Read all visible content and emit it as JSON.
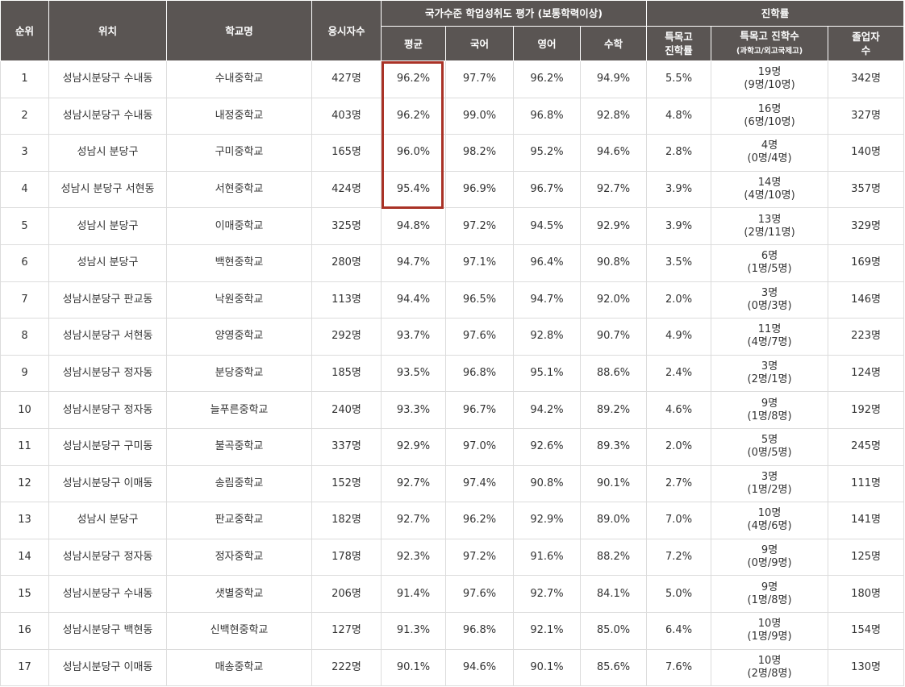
{
  "header": {
    "rank": "순위",
    "location": "위치",
    "school": "학교명",
    "examinees": "응시자수",
    "national_eval": "국가수준 학업성취도 평가 (보통학력이상)",
    "avg": "평균",
    "korean": "국어",
    "english": "영어",
    "math": "수학",
    "advancement": "진학률",
    "special_rate_line1": "특목고",
    "special_rate_line2": "진학률",
    "special_count_line1": "특목고 진학수",
    "special_count_line2": "(과학고/외고국제고)",
    "graduates_line1": "졸업자",
    "graduates_line2": "수"
  },
  "rows": [
    {
      "rank": "1",
      "location": "성남시분당구 수내동",
      "school": "수내중학교",
      "examinees": "427명",
      "avg": "96.2%",
      "korean": "97.7%",
      "english": "96.2%",
      "math": "94.9%",
      "special_rate": "5.5%",
      "special_total": "19명",
      "special_detail": "(9명/10명)",
      "graduates": "342명"
    },
    {
      "rank": "2",
      "location": "성남시분당구 수내동",
      "school": "내정중학교",
      "examinees": "403명",
      "avg": "96.2%",
      "korean": "99.0%",
      "english": "96.8%",
      "math": "92.8%",
      "special_rate": "4.8%",
      "special_total": "16명",
      "special_detail": "(6명/10명)",
      "graduates": "327명"
    },
    {
      "rank": "3",
      "location": "성남시 분당구",
      "school": "구미중학교",
      "examinees": "165명",
      "avg": "96.0%",
      "korean": "98.2%",
      "english": "95.2%",
      "math": "94.6%",
      "special_rate": "2.8%",
      "special_total": "4명",
      "special_detail": "(0명/4명)",
      "graduates": "140명"
    },
    {
      "rank": "4",
      "location": "성남시 분당구 서현동",
      "school": "서현중학교",
      "examinees": "424명",
      "avg": "95.4%",
      "korean": "96.9%",
      "english": "96.7%",
      "math": "92.7%",
      "special_rate": "3.9%",
      "special_total": "14명",
      "special_detail": "(4명/10명)",
      "graduates": "357명"
    },
    {
      "rank": "5",
      "location": "성남시 분당구",
      "school": "이매중학교",
      "examinees": "325명",
      "avg": "94.8%",
      "korean": "97.2%",
      "english": "94.5%",
      "math": "92.9%",
      "special_rate": "3.9%",
      "special_total": "13명",
      "special_detail": "(2명/11명)",
      "graduates": "329명"
    },
    {
      "rank": "6",
      "location": "성남시 분당구",
      "school": "백현중학교",
      "examinees": "280명",
      "avg": "94.7%",
      "korean": "97.1%",
      "english": "96.4%",
      "math": "90.8%",
      "special_rate": "3.5%",
      "special_total": "6명",
      "special_detail": "(1명/5명)",
      "graduates": "169명"
    },
    {
      "rank": "7",
      "location": "성남시분당구 판교동",
      "school": "낙원중학교",
      "examinees": "113명",
      "avg": "94.4%",
      "korean": "96.5%",
      "english": "94.7%",
      "math": "92.0%",
      "special_rate": "2.0%",
      "special_total": "3명",
      "special_detail": "(0명/3명)",
      "graduates": "146명"
    },
    {
      "rank": "8",
      "location": "성남시분당구 서현동",
      "school": "양영중학교",
      "examinees": "292명",
      "avg": "93.7%",
      "korean": "97.6%",
      "english": "92.8%",
      "math": "90.7%",
      "special_rate": "4.9%",
      "special_total": "11명",
      "special_detail": "(4명/7명)",
      "graduates": "223명"
    },
    {
      "rank": "9",
      "location": "성남시분당구 정자동",
      "school": "분당중학교",
      "examinees": "185명",
      "avg": "93.5%",
      "korean": "96.8%",
      "english": "95.1%",
      "math": "88.6%",
      "special_rate": "2.4%",
      "special_total": "3명",
      "special_detail": "(2명/1명)",
      "graduates": "124명"
    },
    {
      "rank": "10",
      "location": "성남시분당구 정자동",
      "school": "늘푸른중학교",
      "examinees": "240명",
      "avg": "93.3%",
      "korean": "96.7%",
      "english": "94.2%",
      "math": "89.2%",
      "special_rate": "4.6%",
      "special_total": "9명",
      "special_detail": "(1명/8명)",
      "graduates": "192명"
    },
    {
      "rank": "11",
      "location": "성남시분당구 구미동",
      "school": "불곡중학교",
      "examinees": "337명",
      "avg": "92.9%",
      "korean": "97.0%",
      "english": "92.6%",
      "math": "89.3%",
      "special_rate": "2.0%",
      "special_total": "5명",
      "special_detail": "(0명/5명)",
      "graduates": "245명"
    },
    {
      "rank": "12",
      "location": "성남시분당구 이매동",
      "school": "송림중학교",
      "examinees": "152명",
      "avg": "92.7%",
      "korean": "97.4%",
      "english": "90.8%",
      "math": "90.1%",
      "special_rate": "2.7%",
      "special_total": "3명",
      "special_detail": "(1명/2명)",
      "graduates": "111명"
    },
    {
      "rank": "13",
      "location": "성남시 분당구",
      "school": "판교중학교",
      "examinees": "182명",
      "avg": "92.7%",
      "korean": "96.2%",
      "english": "92.9%",
      "math": "89.0%",
      "special_rate": "7.0%",
      "special_total": "10명",
      "special_detail": "(4명/6명)",
      "graduates": "141명"
    },
    {
      "rank": "14",
      "location": "성남시분당구 정자동",
      "school": "정자중학교",
      "examinees": "178명",
      "avg": "92.3%",
      "korean": "97.2%",
      "english": "91.6%",
      "math": "88.2%",
      "special_rate": "7.2%",
      "special_total": "9명",
      "special_detail": "(0명/9명)",
      "graduates": "125명"
    },
    {
      "rank": "15",
      "location": "성남시분당구 수내동",
      "school": "샛별중학교",
      "examinees": "206명",
      "avg": "91.4%",
      "korean": "97.6%",
      "english": "92.7%",
      "math": "84.1%",
      "special_rate": "5.0%",
      "special_total": "9명",
      "special_detail": "(1명/8명)",
      "graduates": "180명"
    },
    {
      "rank": "16",
      "location": "성남시분당구 백현동",
      "school": "신백현중학교",
      "examinees": "127명",
      "avg": "91.3%",
      "korean": "96.8%",
      "english": "92.1%",
      "math": "85.0%",
      "special_rate": "6.4%",
      "special_total": "10명",
      "special_detail": "(1명/9명)",
      "graduates": "154명"
    },
    {
      "rank": "17",
      "location": "성남시분당구 이매동",
      "school": "매송중학교",
      "examinees": "222명",
      "avg": "90.1%",
      "korean": "94.6%",
      "english": "90.1%",
      "math": "85.6%",
      "special_rate": "7.6%",
      "special_total": "10명",
      "special_detail": "(2명/8명)",
      "graduates": "130명"
    }
  ],
  "highlight": {
    "color": "#a93226"
  }
}
